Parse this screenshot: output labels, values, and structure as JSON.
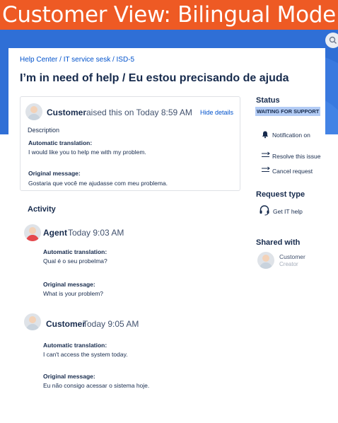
{
  "banner": {
    "title": "Customer View: Bilingual Mode"
  },
  "header": {
    "search_icon": "search-icon"
  },
  "breadcrumb": "Help Center / IT service sesk / ISD-5",
  "request": {
    "title": "I’m in need of help / Eu estou precisando de ajuda",
    "reporter": "Customer",
    "raised_text": "raised this on Today 8:59 AM",
    "hide_details": "Hide details",
    "description_label": "Description",
    "auto_label": "Automatic translation:",
    "auto_text": "I would like you to help me with my problem.",
    "orig_label": "Original message:",
    "orig_text": "Gostaria que você me ajudasse com meu problema."
  },
  "activity": {
    "heading": "Activity",
    "items": [
      {
        "author": "Agent",
        "time": "Today 9:03 AM",
        "auto_label": "Automatic translation:",
        "auto_text": "Qual é o seu probelma?",
        "orig_label": "Original message:",
        "orig_text": "What is your problem?"
      },
      {
        "author": "Customer",
        "time": "Today 9:05 AM",
        "auto_label": "Automatic translation:",
        "auto_text": "I can't access the system today.",
        "orig_label": "Original message:",
        "orig_text": "Eu não consigo acessar o sistema hoje."
      }
    ]
  },
  "sidebar": {
    "status_heading": "Status",
    "status_badge": "WAITING FOR SUPPORT",
    "status_badge_color": "#b3ccf5",
    "actions": [
      {
        "label": "Notification on",
        "icon": "bell-icon"
      },
      {
        "label": "Resolve this issue",
        "icon": "transition-icon"
      },
      {
        "label": "Cancel request",
        "icon": "transition-icon"
      }
    ],
    "request_type_heading": "Request type",
    "request_type": {
      "label": "Get IT help",
      "icon": "headset-icon"
    },
    "shared_heading": "Shared with",
    "shared": {
      "name": "Customer",
      "role": "Creator"
    }
  },
  "colors": {
    "banner": "#ee5a24",
    "header_blue": "#2f6fd6",
    "link": "#0052cc",
    "text": "#172b4d"
  }
}
